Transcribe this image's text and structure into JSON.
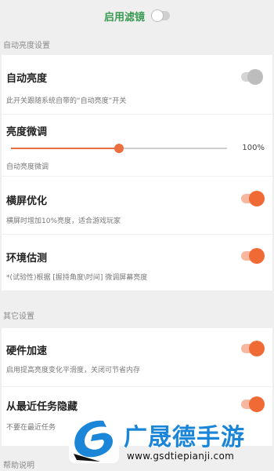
{
  "top": {
    "filter_label": "启用滤镜",
    "filter_on": false
  },
  "sections": {
    "auto_brightness": "自动亮度设置",
    "other": "其它设置",
    "help": "帮助说明"
  },
  "auto_brightness": {
    "title": "自动亮度",
    "desc": "此开关跟随系统自带的“自动亮度”开关",
    "on": false
  },
  "fine_tune": {
    "title": "亮度微调",
    "value": 100,
    "value_label": "100%",
    "level": 0.5,
    "desc": "自动亮度微调"
  },
  "landscape": {
    "title": "横屏优化",
    "desc": "横屏时增加10%亮度，适合游戏玩家",
    "on": true
  },
  "env": {
    "title": "环境估测",
    "desc": "*(试验性)根据 [握持角度\\时间] 微调屏幕亮度",
    "on": true
  },
  "hw": {
    "title": "硬件加速",
    "desc": "启用提高亮度变化平滑度，关闭可节省内存",
    "on": true
  },
  "recent": {
    "title": "从最近任务隐藏",
    "desc": "不要在最近任务",
    "on": true
  },
  "watermark": {
    "name": "广晟德手游",
    "url": "www.gsdtiepianji.com"
  },
  "colors": {
    "accent": "#f06a35",
    "title_green": "#3a9a53",
    "watermark_blue": "#1b86d8"
  }
}
